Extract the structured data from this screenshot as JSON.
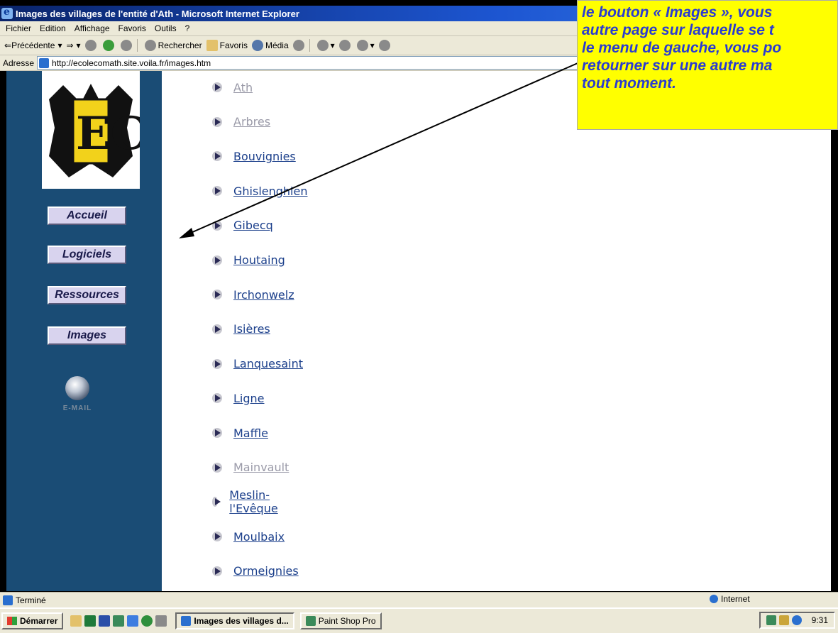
{
  "window": {
    "title": "Images des villages de l'entité d'Ath - Microsoft Internet Explorer"
  },
  "menu": [
    "Fichier",
    "Edition",
    "Affichage",
    "Favoris",
    "Outils",
    "?"
  ],
  "toolbar": {
    "back_label": "Précédente",
    "search_label": "Rechercher",
    "favorites_label": "Favoris",
    "media_label": "Média"
  },
  "address": {
    "label": "Adresse",
    "url": "http://ecolecomath.site.voila.fr/images.htm"
  },
  "nav": {
    "buttons": [
      "Accueil",
      "Logiciels",
      "Ressources",
      "Images"
    ],
    "email_label": "E-MAIL"
  },
  "villages": [
    {
      "name": "Ath",
      "color": "#9a9aa8"
    },
    {
      "name": "Arbres",
      "color": "#9a9aa8"
    },
    {
      "name": "Bouvignies",
      "color": "#1b3f8b"
    },
    {
      "name": "Ghislenghien",
      "color": "#1b3f8b"
    },
    {
      "name": "Gibecq",
      "color": "#1b3f8b"
    },
    {
      "name": "Houtaing",
      "color": "#1b3f8b"
    },
    {
      "name": "Irchonwelz",
      "color": "#1b3f8b"
    },
    {
      "name": "Isières",
      "color": "#1b3f8b"
    },
    {
      "name": "Lanquesaint",
      "color": "#1b3f8b"
    },
    {
      "name": "Ligne",
      "color": "#1b3f8b"
    },
    {
      "name": "Maffle",
      "color": "#1b3f8b"
    },
    {
      "name": "Mainvault",
      "color": "#9a9aa8"
    },
    {
      "name": "Meslin-l'Evêque",
      "color": "#1b3f8b"
    },
    {
      "name": "Moulbaix",
      "color": "#1b3f8b"
    },
    {
      "name": "Ormeignies",
      "color": "#1b3f8b"
    }
  ],
  "callout": {
    "lines": [
      "le bouton « Images », vous",
      "autre page sur laquelle se t",
      "le menu de gauche, vous po",
      "retourner sur une autre ma",
      "tout moment."
    ]
  },
  "status": {
    "text": "Terminé",
    "zone": "Internet"
  },
  "taskbar": {
    "start_label": "Démarrer",
    "tasks": [
      "Images des villages d...",
      "Paint Shop Pro"
    ],
    "clock": "9:31"
  }
}
